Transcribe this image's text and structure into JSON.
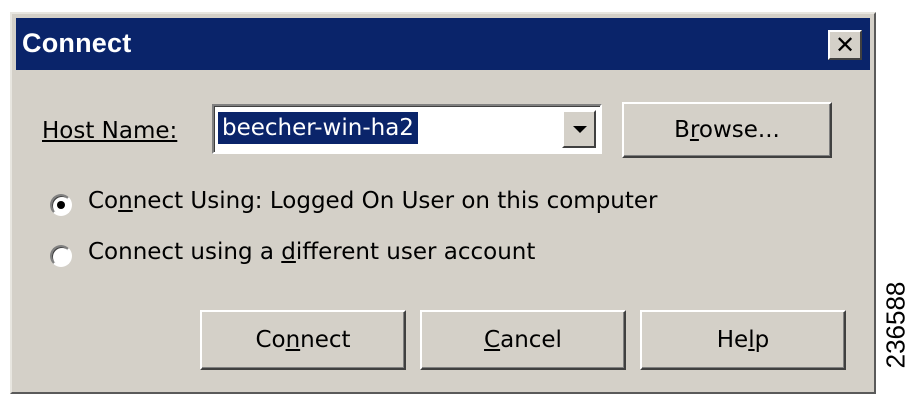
{
  "window": {
    "title": "Connect",
    "close_glyph": "✕"
  },
  "host": {
    "label": "Host Name:",
    "value": "beecher-win-ha2",
    "dropdown_icon": "chevron-down-icon"
  },
  "browse_button": {
    "label_pre": "B",
    "label_accel": "r",
    "label_post": "owse..."
  },
  "options": [
    {
      "label_pre": "Co",
      "label_accel": "n",
      "label_post": "nect Using: Logged On User on this computer",
      "selected": true
    },
    {
      "label_pre": "Connect using a ",
      "label_accel": "d",
      "label_post": "ifferent user account",
      "selected": false
    }
  ],
  "buttons": {
    "connect": {
      "pre": "Co",
      "accel": "n",
      "post": "nect"
    },
    "cancel": {
      "pre": "",
      "accel": "C",
      "post": "ancel"
    },
    "help": {
      "pre": "He",
      "accel": "l",
      "post": "p"
    }
  },
  "figure_id": "236588"
}
